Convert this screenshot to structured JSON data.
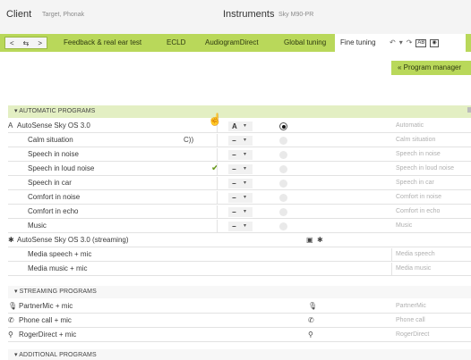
{
  "header": {
    "client_label": "Client",
    "client_name": "Target, Phonak",
    "instruments_label": "Instruments",
    "instruments_model": "Sky M90-PR"
  },
  "nav": {
    "back": "<",
    "swap": "⇆",
    "forward": ">",
    "tabs": [
      {
        "label": "Feedback & real ear test"
      },
      {
        "label": "ECLD"
      },
      {
        "label": "AudiogramDirect"
      },
      {
        "label": "Global tuning"
      },
      {
        "label": "Fine tuning"
      }
    ],
    "tools": {
      "undo": "↶",
      "dropdown": "▾",
      "redo": "↷",
      "ab": "AB",
      "stop": "◉"
    }
  },
  "program_manager_button": "« Program manager",
  "sections": {
    "automatic": "AUTOMATIC PROGRAMS",
    "streaming": "STREAMING PROGRAMS",
    "additional": "ADDITIONAL PROGRAMS"
  },
  "automatic": {
    "autosense": {
      "label": "AutoSense Sky OS 3.0",
      "select_value": "A",
      "right": "Automatic"
    },
    "programs": [
      {
        "label": "Calm situation",
        "right": "Calm situation",
        "sel": "−",
        "radio": "off",
        "badge": "C))",
        "check": ""
      },
      {
        "label": "Speech in noise",
        "right": "Speech in noise",
        "sel": "−",
        "radio": "off",
        "badge": "",
        "check": ""
      },
      {
        "label": "Speech in loud noise",
        "right": "Speech in loud noise",
        "sel": "−",
        "radio": "off",
        "badge": "",
        "check": "✔"
      },
      {
        "label": "Speech in car",
        "right": "Speech in car",
        "sel": "−",
        "radio": "off",
        "badge": "",
        "check": ""
      },
      {
        "label": "Comfort in noise",
        "right": "Comfort in noise",
        "sel": "−",
        "radio": "off",
        "badge": "",
        "check": ""
      },
      {
        "label": "Comfort in echo",
        "right": "Comfort in echo",
        "sel": "−",
        "radio": "off",
        "badge": "",
        "check": ""
      },
      {
        "label": "Music",
        "right": "Music",
        "sel": "−",
        "radio": "off",
        "badge": "",
        "check": ""
      }
    ],
    "streaming_autosense": {
      "label": "AutoSense Sky OS 3.0 (streaming)"
    },
    "media": [
      {
        "label": "Media speech + mic",
        "right": "Media speech"
      },
      {
        "label": "Media music + mic",
        "right": "Media music"
      }
    ]
  },
  "streaming": [
    {
      "label": "PartnerMic + mic",
      "right": "PartnerMic",
      "icon": "🎙"
    },
    {
      "label": "Phone call + mic",
      "right": "Phone call",
      "icon": "✆"
    },
    {
      "label": "RogerDirect + mic",
      "right": "RogerDirect",
      "icon": "⚲"
    }
  ]
}
